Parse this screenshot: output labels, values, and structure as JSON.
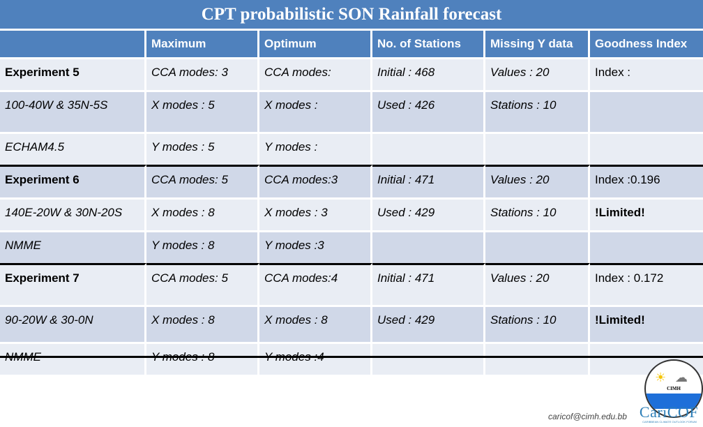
{
  "title": "CPT probabilistic SON Rainfall forecast",
  "headers": [
    "",
    "Maximum",
    "Optimum",
    "No. of Stations",
    "Missing Y data",
    "Goodness Index"
  ],
  "rows": [
    {
      "cells": [
        "Experiment 5",
        "CCA modes: 3",
        "CCA modes:",
        "Initial : 468",
        "Values : 20",
        "Index :"
      ],
      "shade": "a",
      "sep": false
    },
    {
      "cells": [
        "100-40W & 35N-5S",
        "X modes : 5",
        "X modes :",
        "Used : 426",
        "Stations : 10",
        ""
      ],
      "shade": "b",
      "sep": false
    },
    {
      "cells": [
        "ECHAM4.5",
        "Y modes : 5",
        "Y modes :",
        "",
        "",
        ""
      ],
      "shade": "a",
      "sep": false
    },
    {
      "cells": [
        "Experiment 6",
        "CCA modes: 5",
        "CCA modes:3",
        "Initial : 471",
        "Values : 20",
        "Index :0.196"
      ],
      "shade": "b",
      "sep": true
    },
    {
      "cells": [
        "140E-20W & 30N-20S",
        "X modes : 8",
        "X modes : 3",
        "Used : 429",
        "Stations : 10",
        "!Limited!"
      ],
      "shade": "a",
      "sep": false
    },
    {
      "cells": [
        "NMME",
        "Y modes : 8",
        "Y modes :3",
        "",
        "",
        ""
      ],
      "shade": "b",
      "sep": false
    },
    {
      "cells": [
        "Experiment 7",
        "CCA modes: 5",
        "CCA modes:4",
        "Initial : 471",
        "Values : 20",
        "Index : 0.172"
      ],
      "shade": "a",
      "sep": true
    },
    {
      "cells": [
        "90-20W & 30-0N",
        "X modes : 8",
        "X modes : 8",
        "Used : 429",
        "Stations : 10",
        "!Limited!"
      ],
      "shade": "b",
      "sep": false
    },
    {
      "cells": [
        "NMME",
        "Y modes : 8",
        "Y modes :4",
        "",
        "",
        ""
      ],
      "shade": "a",
      "sep": false
    }
  ],
  "footer": {
    "email": "caricof@cimh.edu.bb",
    "cimh_label": "CIMH",
    "caricof_label": "CariCOF",
    "caricof_sub": "CARIBBEAN CLIMATE OUTLOOK FORUM"
  }
}
